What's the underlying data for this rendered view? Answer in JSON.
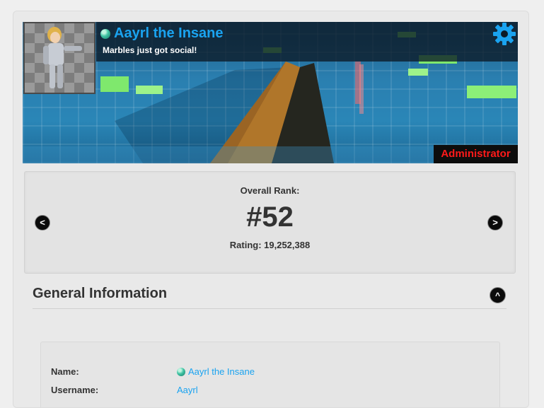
{
  "profile": {
    "display_name": "Aayrl the Insane",
    "motto": "Marbles just got social!",
    "role": "Administrator",
    "status_icon": "marble-status-icon",
    "settings_icon": "gear-icon"
  },
  "rank": {
    "label": "Overall Rank:",
    "value": "#52",
    "rating": "Rating: 19,252,388",
    "prev_label": "<",
    "next_label": ">"
  },
  "general_info": {
    "title": "General Information",
    "collapse_label": "^",
    "rows": [
      {
        "label": "Name:",
        "value": "Aayrl the Insane"
      },
      {
        "label": "Username:",
        "value": "Aayrl"
      }
    ]
  },
  "colors": {
    "link": "#1aa3f0",
    "role": "#ff1a1a",
    "text": "#333333"
  }
}
